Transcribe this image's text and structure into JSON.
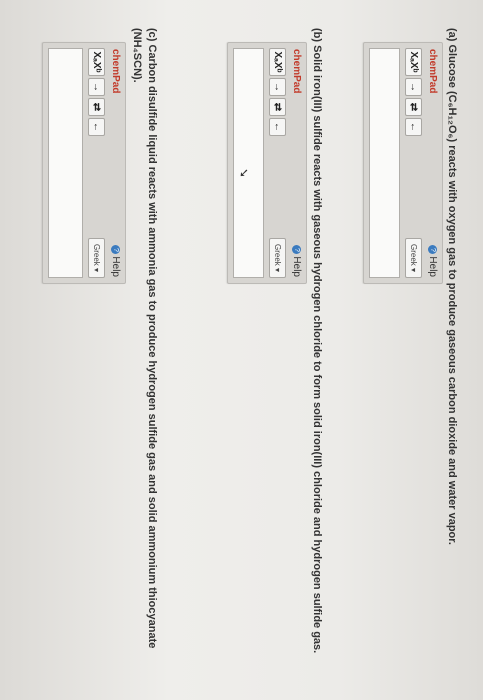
{
  "questions": [
    {
      "id": "a",
      "text": "(a) Glucose (C₆H₁₂O₆) reacts with oxygen gas to produce gaseous carbon dioxide and water vapor.",
      "pad": {
        "title": "chemPad",
        "help": "Help",
        "greek": "Greek ▾",
        "buttons": [
          "XₐXᵇ",
          "→",
          "⇄",
          "←"
        ],
        "value": ""
      }
    },
    {
      "id": "b",
      "text": "(b) Solid iron(III) sulfide reacts with gaseous hydrogen chloride to form solid iron(III) chloride and hydrogen sulfide gas.",
      "pad": {
        "title": "chemPad",
        "help": "Help",
        "greek": "Greek ▾",
        "buttons": [
          "XₐXᵇ",
          "→",
          "⇄",
          "←"
        ],
        "value": ""
      }
    },
    {
      "id": "c",
      "text": "(c) Carbon disulfide liquid reacts with ammonia gas to produce hydrogen sulfide gas and solid ammonium thiocyanate",
      "text2": "(NH₄SCN).",
      "pad": {
        "title": "chemPad",
        "help": "Help",
        "greek": "Greek ▾",
        "buttons": [
          "XₐXᵇ",
          "→",
          "⇄",
          "←"
        ],
        "value": ""
      }
    }
  ]
}
